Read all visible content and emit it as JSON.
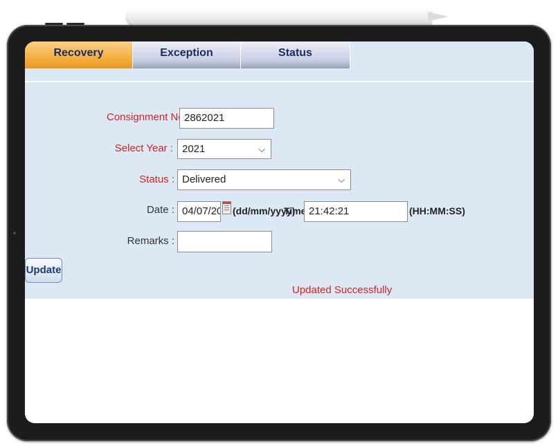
{
  "tabs": [
    "Recovery",
    "Exception",
    "Status"
  ],
  "form": {
    "consignment_label": "Consignment No :",
    "consignment_value": "2862021",
    "year_label": "Select Year :",
    "year_value": "2021",
    "status_label": "Status :",
    "status_value": "Delivered",
    "date_label": "Date :",
    "date_value": "04/07/2021",
    "date_format": "(dd/mm/yyyy)",
    "time_label": "Time:",
    "time_value": "21:42:21",
    "time_format": "(HH:MM:SS)",
    "remarks_label": "Remarks :",
    "remarks_value": ""
  },
  "update_label": "Update",
  "message": "Updated Successfully",
  "icons": {
    "calendar": "calendar-icon",
    "dropdown": "chevron-down-icon"
  },
  "colors": {
    "active_tab": "#f2ab38",
    "label_red": "#d22323",
    "form_bg": "#dde8f5"
  }
}
